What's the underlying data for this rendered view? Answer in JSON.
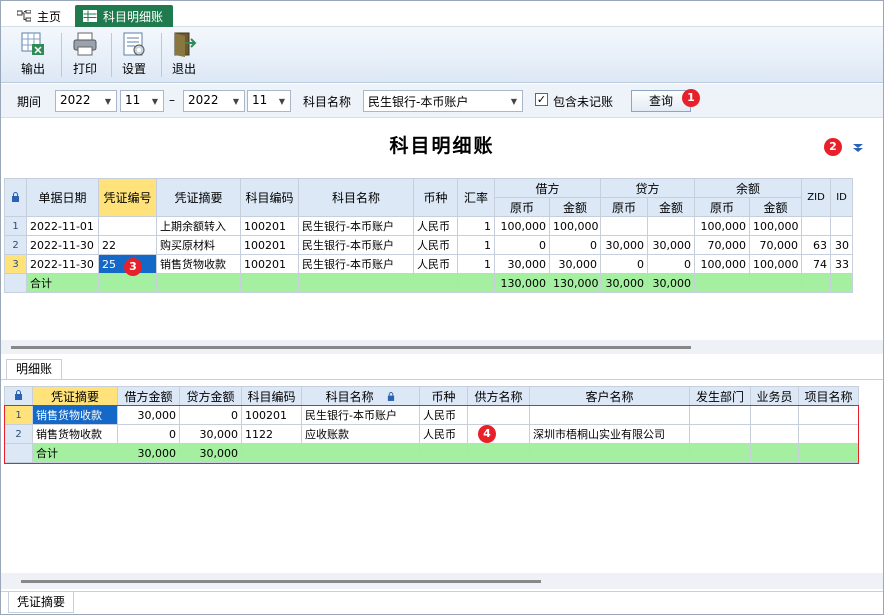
{
  "tabs": {
    "home": "主页",
    "active": "科目明细账"
  },
  "toolbar": {
    "export": "输出",
    "print": "打印",
    "settings": "设置",
    "exit": "退出"
  },
  "query": {
    "period_label": "期间",
    "from_year": "2022",
    "from_month": "11",
    "dash": "–",
    "to_year": "2022",
    "to_month": "11",
    "account_label": "科目名称",
    "account_value": "民生银行-本币账户",
    "include_label": "包含未记账",
    "include_checked": "✓",
    "query_button": "查询"
  },
  "badges": {
    "b1": "1",
    "b2": "2",
    "b3": "3",
    "b4": "4"
  },
  "title": "科目明细账",
  "ledger": {
    "headers": {
      "date": "单据日期",
      "voucher_no": "凭证编号",
      "summary": "凭证摘要",
      "account_code": "科目编码",
      "account_name": "科目名称",
      "currency": "币种",
      "rate": "汇率",
      "debit": "借方",
      "credit": "贷方",
      "balance": "余额",
      "orig": "原币",
      "amount": "金额",
      "zid": "ZID",
      "id": "ID"
    },
    "rows": [
      {
        "rn": "1",
        "date": "2022-11-01",
        "voucher": "",
        "summary": "上期余额转入",
        "code": "100201",
        "name": "民生银行-本币账户",
        "currency": "人民币",
        "rate": "1",
        "d_orig": "100,000",
        "d_amt": "100,000",
        "c_orig": "",
        "c_amt": "",
        "b_orig": "100,000",
        "b_amt": "100,000",
        "zid": "",
        "id": ""
      },
      {
        "rn": "2",
        "date": "2022-11-30",
        "voucher": "22",
        "summary": "购买原材料",
        "code": "100201",
        "name": "民生银行-本币账户",
        "currency": "人民币",
        "rate": "1",
        "d_orig": "0",
        "d_amt": "0",
        "c_orig": "30,000",
        "c_amt": "30,000",
        "b_orig": "70,000",
        "b_amt": "70,000",
        "zid": "63",
        "id": "30"
      },
      {
        "rn": "3",
        "date": "2022-11-30",
        "voucher": "25",
        "summary": "销售货物收款",
        "code": "100201",
        "name": "民生银行-本币账户",
        "currency": "人民币",
        "rate": "1",
        "d_orig": "30,000",
        "d_amt": "30,000",
        "c_orig": "0",
        "c_amt": "0",
        "b_orig": "100,000",
        "b_amt": "100,000",
        "zid": "74",
        "id": "33"
      }
    ],
    "total": {
      "label": "合计",
      "d_orig": "130,000",
      "d_amt": "130,000",
      "c_orig": "30,000",
      "c_amt": "30,000"
    }
  },
  "detail_tab": "明细账",
  "detail": {
    "headers": {
      "summary": "凭证摘要",
      "debit": "借方金额",
      "credit": "贷方金额",
      "code": "科目编码",
      "name": "科目名称",
      "currency": "币种",
      "supplier": "供方名称",
      "customer": "客户名称",
      "dept": "发生部门",
      "staff": "业务员",
      "project": "项目名称"
    },
    "rows": [
      {
        "rn": "1",
        "summary": "销售货物收款",
        "debit": "30,000",
        "credit": "0",
        "code": "100201",
        "name": "民生银行-本币账户",
        "currency": "人民币",
        "supplier": "",
        "customer": "",
        "dept": "",
        "staff": "",
        "project": ""
      },
      {
        "rn": "2",
        "summary": "销售货物收款",
        "debit": "0",
        "credit": "30,000",
        "code": "1122",
        "name": "应收账款",
        "currency": "人民币",
        "supplier": "",
        "customer": "深圳市梧桐山实业有限公司",
        "dept": "",
        "staff": "",
        "project": ""
      }
    ],
    "total": {
      "label": "合计",
      "debit": "30,000",
      "credit": "30,000"
    }
  },
  "bottom_tab": "凭证摘要"
}
